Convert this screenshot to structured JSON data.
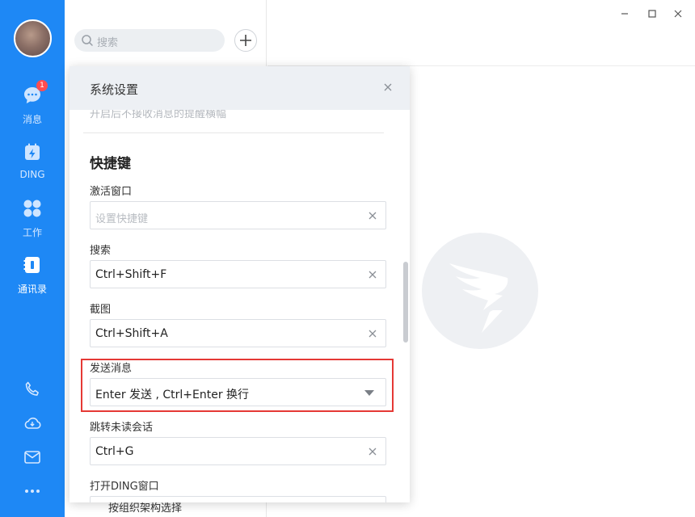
{
  "nav": {
    "items": [
      {
        "label": "消息",
        "icon": "chat-bubble-icon",
        "badge": "1"
      },
      {
        "label": "DING",
        "icon": "ding-calendar-icon"
      },
      {
        "label": "工作",
        "icon": "workspace-grid-icon"
      },
      {
        "label": "通讯录",
        "icon": "contacts-book-icon",
        "active": true
      }
    ],
    "bottom_icons": [
      "phone-icon",
      "cloud-icon",
      "mail-icon",
      "more-icon"
    ]
  },
  "list": {
    "search_placeholder": "搜索",
    "peek_text": "按组织架构选择"
  },
  "dialog": {
    "title": "系统设置",
    "cut_text": "开启后不接收消息的提醒横幅",
    "section_title": "快捷键",
    "fields": [
      {
        "label": "激活窗口",
        "value": "",
        "placeholder": "设置快捷键",
        "control": "clear"
      },
      {
        "label": "搜索",
        "value": "Ctrl+Shift+F",
        "control": "clear"
      },
      {
        "label": "截图",
        "value": "Ctrl+Shift+A",
        "control": "clear"
      },
      {
        "label": "发送消息",
        "value": "Enter 发送 , Ctrl+Enter 换行",
        "control": "dropdown",
        "highlighted": true
      },
      {
        "label": "跳转未读会话",
        "value": "Ctrl+G",
        "control": "clear"
      },
      {
        "label": "打开DING窗口",
        "value": "",
        "control": "clear"
      }
    ]
  },
  "colors": {
    "nav_bg": "#1e88f5",
    "highlight_border": "#e53935",
    "dialog_header_bg": "#edf0f4"
  }
}
